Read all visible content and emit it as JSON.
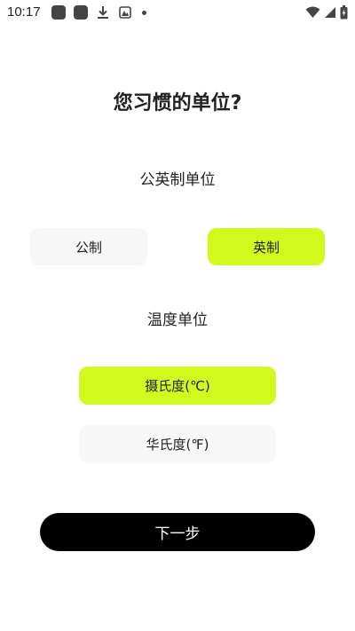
{
  "status_bar": {
    "time": "10:17",
    "left_icons": [
      "app-icon",
      "app-icon",
      "download-icon",
      "photo-icon",
      "dot-icon"
    ],
    "right_icons": [
      "wifi-icon",
      "signal-icon",
      "battery-icon"
    ]
  },
  "page": {
    "title": "您习惯的单位?"
  },
  "unit_system": {
    "title": "公英制单位",
    "options": [
      {
        "label": "公制",
        "selected": false
      },
      {
        "label": "英制",
        "selected": true
      }
    ]
  },
  "temperature": {
    "title": "温度单位",
    "options": [
      {
        "label": "摄氏度(℃)",
        "selected": true
      },
      {
        "label": "华氏度(℉)",
        "selected": false
      }
    ]
  },
  "actions": {
    "next_label": "下一步"
  },
  "colors": {
    "accent": "#d2f91d",
    "unselected_bg": "#f7f7f7",
    "button_bg": "#000000",
    "button_text": "#ffffff"
  }
}
